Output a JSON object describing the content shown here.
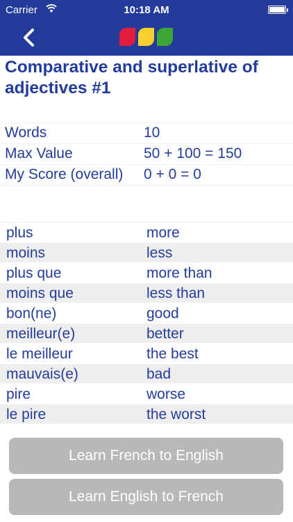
{
  "status_bar": {
    "carrier": "Carrier",
    "time": "10:18 AM"
  },
  "nav": {
    "back_icon": "chevron-left-icon",
    "logo_colors": [
      "#e31b3c",
      "#f7cf2e",
      "#3ea537"
    ]
  },
  "title": "Comparative and superlative of adjectives #1",
  "stats": [
    {
      "label": "Words",
      "value": "10"
    },
    {
      "label": "Max Value",
      "value": "50 + 100 = 150"
    },
    {
      "label": "My Score (overall)",
      "value": "0 + 0 = 0"
    }
  ],
  "words": [
    {
      "french": "plus",
      "english": "more"
    },
    {
      "french": "moins",
      "english": "less"
    },
    {
      "french": "plus que",
      "english": "more than"
    },
    {
      "french": "moins que",
      "english": "less than"
    },
    {
      "french": "bon(ne)",
      "english": "good"
    },
    {
      "french": "meilleur(e)",
      "english": "better"
    },
    {
      "french": "le meilleur",
      "english": "the best"
    },
    {
      "french": "mauvais(e)",
      "english": "bad"
    },
    {
      "french": "pire",
      "english": "worse"
    },
    {
      "french": "le pire",
      "english": "the worst"
    }
  ],
  "buttons": {
    "french_to_english": "Learn French to English",
    "english_to_french": "Learn English to French"
  },
  "colors": {
    "brand_blue": "#233c9b",
    "row_alt": "#eeeeee",
    "button_gray": "#b8b8b8"
  }
}
